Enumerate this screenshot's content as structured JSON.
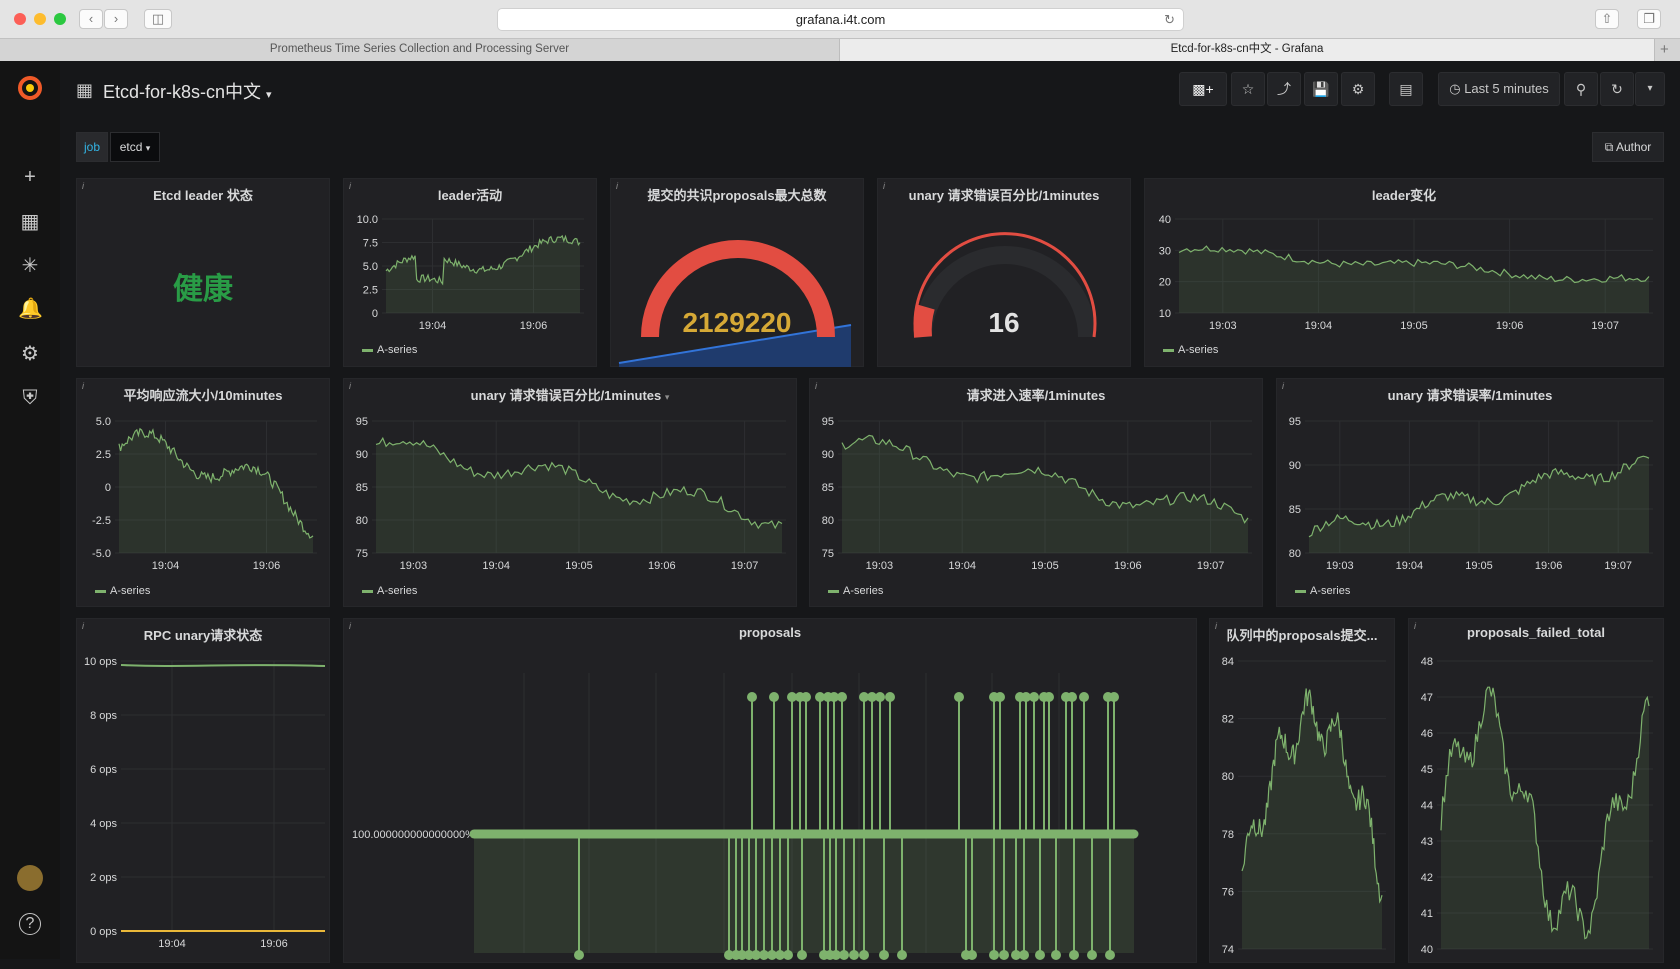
{
  "browser": {
    "url": "grafana.i4t.com",
    "tabs": [
      {
        "label": "Prometheus Time Series Collection and Processing Server"
      },
      {
        "label": "Etcd-for-k8s-cn中文 - Grafana"
      }
    ]
  },
  "dashboard": {
    "title": "Etcd-for-k8s-cn中文",
    "time_range": "Last 5 minutes",
    "variable": {
      "name": "job",
      "value": "etcd"
    },
    "author_link": "Author"
  },
  "colors": {
    "series": "#7eb26d",
    "gauge": "#e24d42",
    "ok": "#299c46",
    "background": "#161719",
    "panel": "#212124"
  },
  "panels": {
    "leader_status": {
      "title": "Etcd leader 状态",
      "value": "健康"
    },
    "leader_activity": {
      "title": "leader活动",
      "legend": "A-series"
    },
    "proposals_max": {
      "title": "提交的共识proposals最大总数",
      "value": "2129220"
    },
    "unary_err_pct_gauge": {
      "title": "unary 请求错误百分比/1minutes",
      "value": "16"
    },
    "leader_change": {
      "title": "leader变化",
      "legend": "A-series"
    },
    "avg_resp_stream": {
      "title": "平均响应流大小/10minutes",
      "legend": "A-series"
    },
    "unary_err_pct": {
      "title": "unary 请求错误百分比/1minutes",
      "legend": "A-series"
    },
    "req_in_rate": {
      "title": "请求进入速率/1minutes",
      "legend": "A-series"
    },
    "unary_err_rate": {
      "title": "unary 请求错误率/1minutes",
      "legend": "A-series"
    },
    "rpc_unary": {
      "title": "RPC unary请求状态"
    },
    "proposals": {
      "title": "proposals",
      "ylabel": "100.000000000000000%"
    },
    "queue_proposals": {
      "title": "队列中的proposals提交..."
    },
    "proposals_failed": {
      "title": "proposals_failed_total"
    }
  },
  "chart_data": [
    {
      "type": "line",
      "title": "leader活动",
      "series": [
        {
          "name": "A-series"
        }
      ],
      "ylim": [
        0,
        10
      ],
      "yticks": [
        "10.0",
        "7.5",
        "5.0",
        "2.5",
        "0"
      ],
      "xticks": [
        "19:04",
        "19:06"
      ]
    },
    {
      "type": "line",
      "title": "leader变化",
      "series": [
        {
          "name": "A-series"
        }
      ],
      "ylim": [
        10,
        40
      ],
      "yticks": [
        "40",
        "30",
        "20",
        "10"
      ],
      "xticks": [
        "19:03",
        "19:04",
        "19:05",
        "19:06",
        "19:07"
      ]
    },
    {
      "type": "line",
      "title": "平均响应流大小/10minutes",
      "series": [
        {
          "name": "A-series"
        }
      ],
      "ylim": [
        -5,
        5
      ],
      "yticks": [
        "5.0",
        "2.5",
        "0",
        "-2.5",
        "-5.0"
      ],
      "xticks": [
        "19:04",
        "19:06"
      ]
    },
    {
      "type": "line",
      "title": "unary 请求错误百分比/1minutes",
      "series": [
        {
          "name": "A-series"
        }
      ],
      "ylim": [
        75,
        95
      ],
      "yticks": [
        "95",
        "90",
        "85",
        "80",
        "75"
      ],
      "xticks": [
        "19:03",
        "19:04",
        "19:05",
        "19:06",
        "19:07"
      ]
    },
    {
      "type": "line",
      "title": "请求进入速率/1minutes",
      "series": [
        {
          "name": "A-series"
        }
      ],
      "ylim": [
        75,
        95
      ],
      "yticks": [
        "95",
        "90",
        "85",
        "80",
        "75"
      ],
      "xticks": [
        "19:03",
        "19:04",
        "19:05",
        "19:06",
        "19:07"
      ]
    },
    {
      "type": "line",
      "title": "unary 请求错误率/1minutes",
      "series": [
        {
          "name": "A-series"
        }
      ],
      "ylim": [
        80,
        95
      ],
      "yticks": [
        "95",
        "90",
        "85",
        "80"
      ],
      "xticks": [
        "19:03",
        "19:04",
        "19:05",
        "19:06",
        "19:07"
      ]
    },
    {
      "type": "line",
      "title": "RPC unary请求状态",
      "ylim": [
        0,
        10
      ],
      "yticks": [
        "10 ops",
        "8 ops",
        "6 ops",
        "4 ops",
        "2 ops",
        "0 ops"
      ],
      "xticks": [
        "19:04",
        "19:06"
      ]
    },
    {
      "type": "line",
      "title": "队列中的proposals提交...",
      "ylim": [
        74,
        84
      ],
      "yticks": [
        "84",
        "82",
        "80",
        "78",
        "76",
        "74"
      ]
    },
    {
      "type": "line",
      "title": "proposals_failed_total",
      "ylim": [
        40,
        48
      ],
      "yticks": [
        "48",
        "47",
        "46",
        "45",
        "44",
        "43",
        "42",
        "41",
        "40"
      ]
    }
  ]
}
